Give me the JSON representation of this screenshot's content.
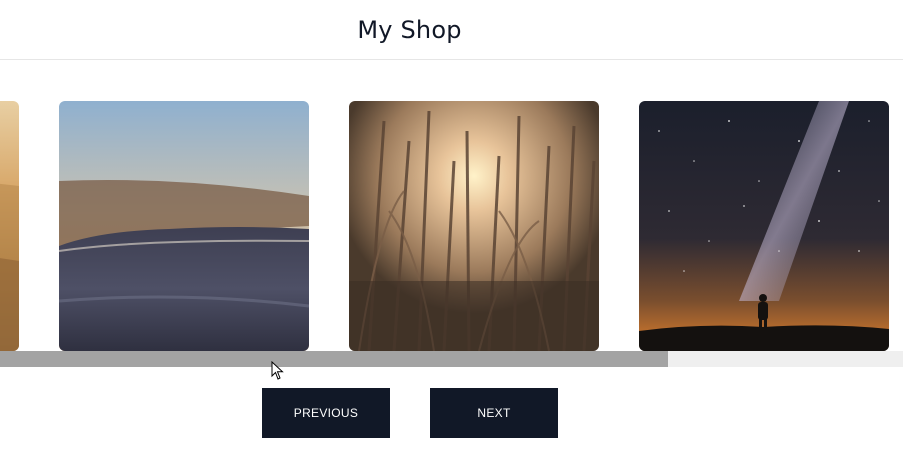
{
  "header": {
    "title": "My Shop"
  },
  "carousel": {
    "images": [
      {
        "name": "golden-sea-photo"
      },
      {
        "name": "ocean-wave-sunset-photo"
      },
      {
        "name": "reeds-sunlight-photo"
      },
      {
        "name": "milky-way-silhouette-photo"
      }
    ],
    "scroll_fraction": 0.74
  },
  "controls": {
    "previous_label": "PREVIOUS",
    "next_label": "NEXT"
  },
  "colors": {
    "button_bg": "#111827",
    "button_text": "#ffffff",
    "scroll_track": "#efefef",
    "scroll_thumb": "#a3a3a3"
  }
}
